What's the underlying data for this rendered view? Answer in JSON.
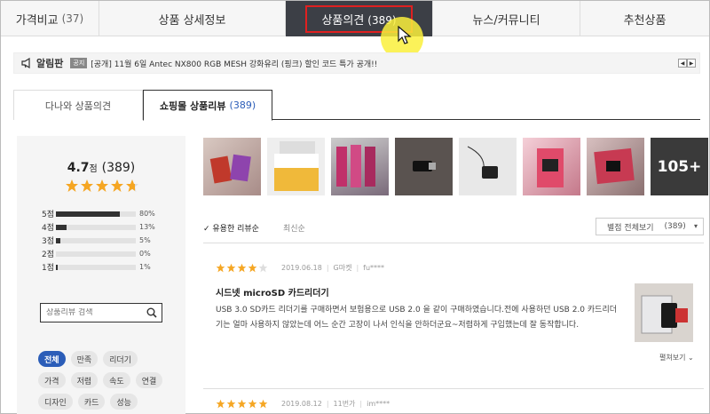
{
  "top_tabs": [
    {
      "label": "가격비교",
      "count": "(37)"
    },
    {
      "label": "상품 상세정보",
      "count": ""
    },
    {
      "label": "상품의견",
      "count": "(389)"
    },
    {
      "label": "뉴스/커뮤니티",
      "count": ""
    },
    {
      "label": "추천상품",
      "count": ""
    }
  ],
  "notice": {
    "title": "알림판",
    "badge": "공지",
    "text": "[공개] 11월 6일 Antec NX800 RGB MESH 강화유리 (핑크) 할인 코드 특가 공개!!",
    "prev": "◀",
    "next": "▶"
  },
  "sub_tabs": [
    {
      "label": "다나와 상품의견",
      "count": ""
    },
    {
      "label": "쇼핑몰 상품리뷰",
      "count": "(389)"
    }
  ],
  "summary": {
    "score": "4.7",
    "unit": "점",
    "count": "(389)",
    "distribution": [
      {
        "label": "5점",
        "pct": "80%",
        "value": 0.8
      },
      {
        "label": "4점",
        "pct": "13%",
        "value": 0.13
      },
      {
        "label": "3점",
        "pct": "5%",
        "value": 0.05
      },
      {
        "label": "2점",
        "pct": "0%",
        "value": 0.0
      },
      {
        "label": "1점",
        "pct": "1%",
        "value": 0.01
      }
    ]
  },
  "search": {
    "placeholder": "상품리뷰 검색"
  },
  "tags": [
    "전체",
    "만족",
    "리더기",
    "가격",
    "저렴",
    "속도",
    "연결",
    "디자인",
    "카드",
    "성능"
  ],
  "photos": {
    "more_label": "105+"
  },
  "sort": {
    "helpful": "✓ 유용한 리뷰순",
    "latest": "최신순",
    "filter_label": "별점 전체보기",
    "filter_count": "(389)",
    "chevron": "▾"
  },
  "reviews": [
    {
      "rating": 4,
      "date": "2019.06.18",
      "mall": "G마켓",
      "user": "fu****",
      "title": "시드넷 microSD 카드리더기",
      "body": "USB 3.0 SD카드 리더기를 구매하면서 보험용으로 USB 2.0 을 같이 구매하였습니다.전에 사용하던 USB 2.0 카드리더기는 얼마 사용하지 않았는데 어느 순간 고장이 나서 인식을 안하더군요~저렴하게 구입했는데 잘 동작합니다.",
      "more": "펼쳐보기 ⌄"
    },
    {
      "rating": 5,
      "date": "2019.08.12",
      "mall": "11번가",
      "user": "im****"
    }
  ],
  "colors": {
    "accent": "#2b5db8",
    "active_tab_bg": "#3c3f46",
    "highlight_box": "#e02020",
    "star": "#f5a623"
  }
}
